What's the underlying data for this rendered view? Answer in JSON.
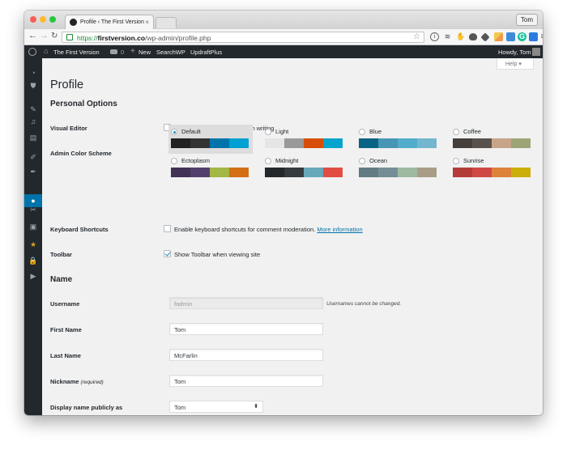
{
  "browser": {
    "tab_title": "Profile ‹ The First Version",
    "tab_close": "×",
    "profile_user": "Tom",
    "url_scheme": "https://",
    "url_domain": "firstversion.co",
    "url_path": "/wp-admin/profile.php"
  },
  "admin_bar": {
    "site_name": "The First Version",
    "comments_count": "0",
    "new_label": "New",
    "search_label": "SearchWP",
    "updraft_label": "UpdraftPlus",
    "greeting": "Howdy, Tom"
  },
  "help_tab": "Help ▾",
  "page_title": "Profile",
  "personal_options": {
    "heading": "Personal Options",
    "visual_editor_label": "Visual Editor",
    "visual_editor_text": "Disable the visual editor when writing",
    "color_scheme_label": "Admin Color Scheme",
    "schemes": [
      {
        "name": "Default",
        "selected": true,
        "colors": [
          "#222222",
          "#333333",
          "#0073aa",
          "#00a0d2"
        ]
      },
      {
        "name": "Light",
        "selected": false,
        "colors": [
          "#e5e5e5",
          "#999999",
          "#d64e07",
          "#04a4cc"
        ]
      },
      {
        "name": "Blue",
        "selected": false,
        "colors": [
          "#096484",
          "#4796b3",
          "#52accc",
          "#74b6ce"
        ]
      },
      {
        "name": "Coffee",
        "selected": false,
        "colors": [
          "#46403c",
          "#59524c",
          "#c7a589",
          "#9ea476"
        ]
      },
      {
        "name": "Ectoplasm",
        "selected": false,
        "colors": [
          "#413256",
          "#523f6d",
          "#a3b745",
          "#d46f15"
        ]
      },
      {
        "name": "Midnight",
        "selected": false,
        "colors": [
          "#25282b",
          "#363b3f",
          "#69a8bb",
          "#e14d43"
        ]
      },
      {
        "name": "Ocean",
        "selected": false,
        "colors": [
          "#627c83",
          "#738e96",
          "#9ebaa0",
          "#aa9d88"
        ]
      },
      {
        "name": "Sunrise",
        "selected": false,
        "colors": [
          "#b43c38",
          "#cf4944",
          "#dd823b",
          "#ccaf0b"
        ]
      }
    ],
    "keyboard_label": "Keyboard Shortcuts",
    "keyboard_text": "Enable keyboard shortcuts for comment moderation.",
    "keyboard_link": "More information",
    "toolbar_label": "Toolbar",
    "toolbar_text": "Show Toolbar when viewing site"
  },
  "name_section": {
    "heading": "Name",
    "username_label": "Username",
    "username_value": "fadmin",
    "username_note": "Usernames cannot be changed.",
    "first_name_label": "First Name",
    "first_name_value": "Tom",
    "last_name_label": "Last Name",
    "last_name_value": "McFarlin",
    "nickname_label": "Nickname",
    "nickname_required": "(required)",
    "nickname_value": "Tom",
    "display_label": "Display name publicly as",
    "display_value": "Tom"
  }
}
